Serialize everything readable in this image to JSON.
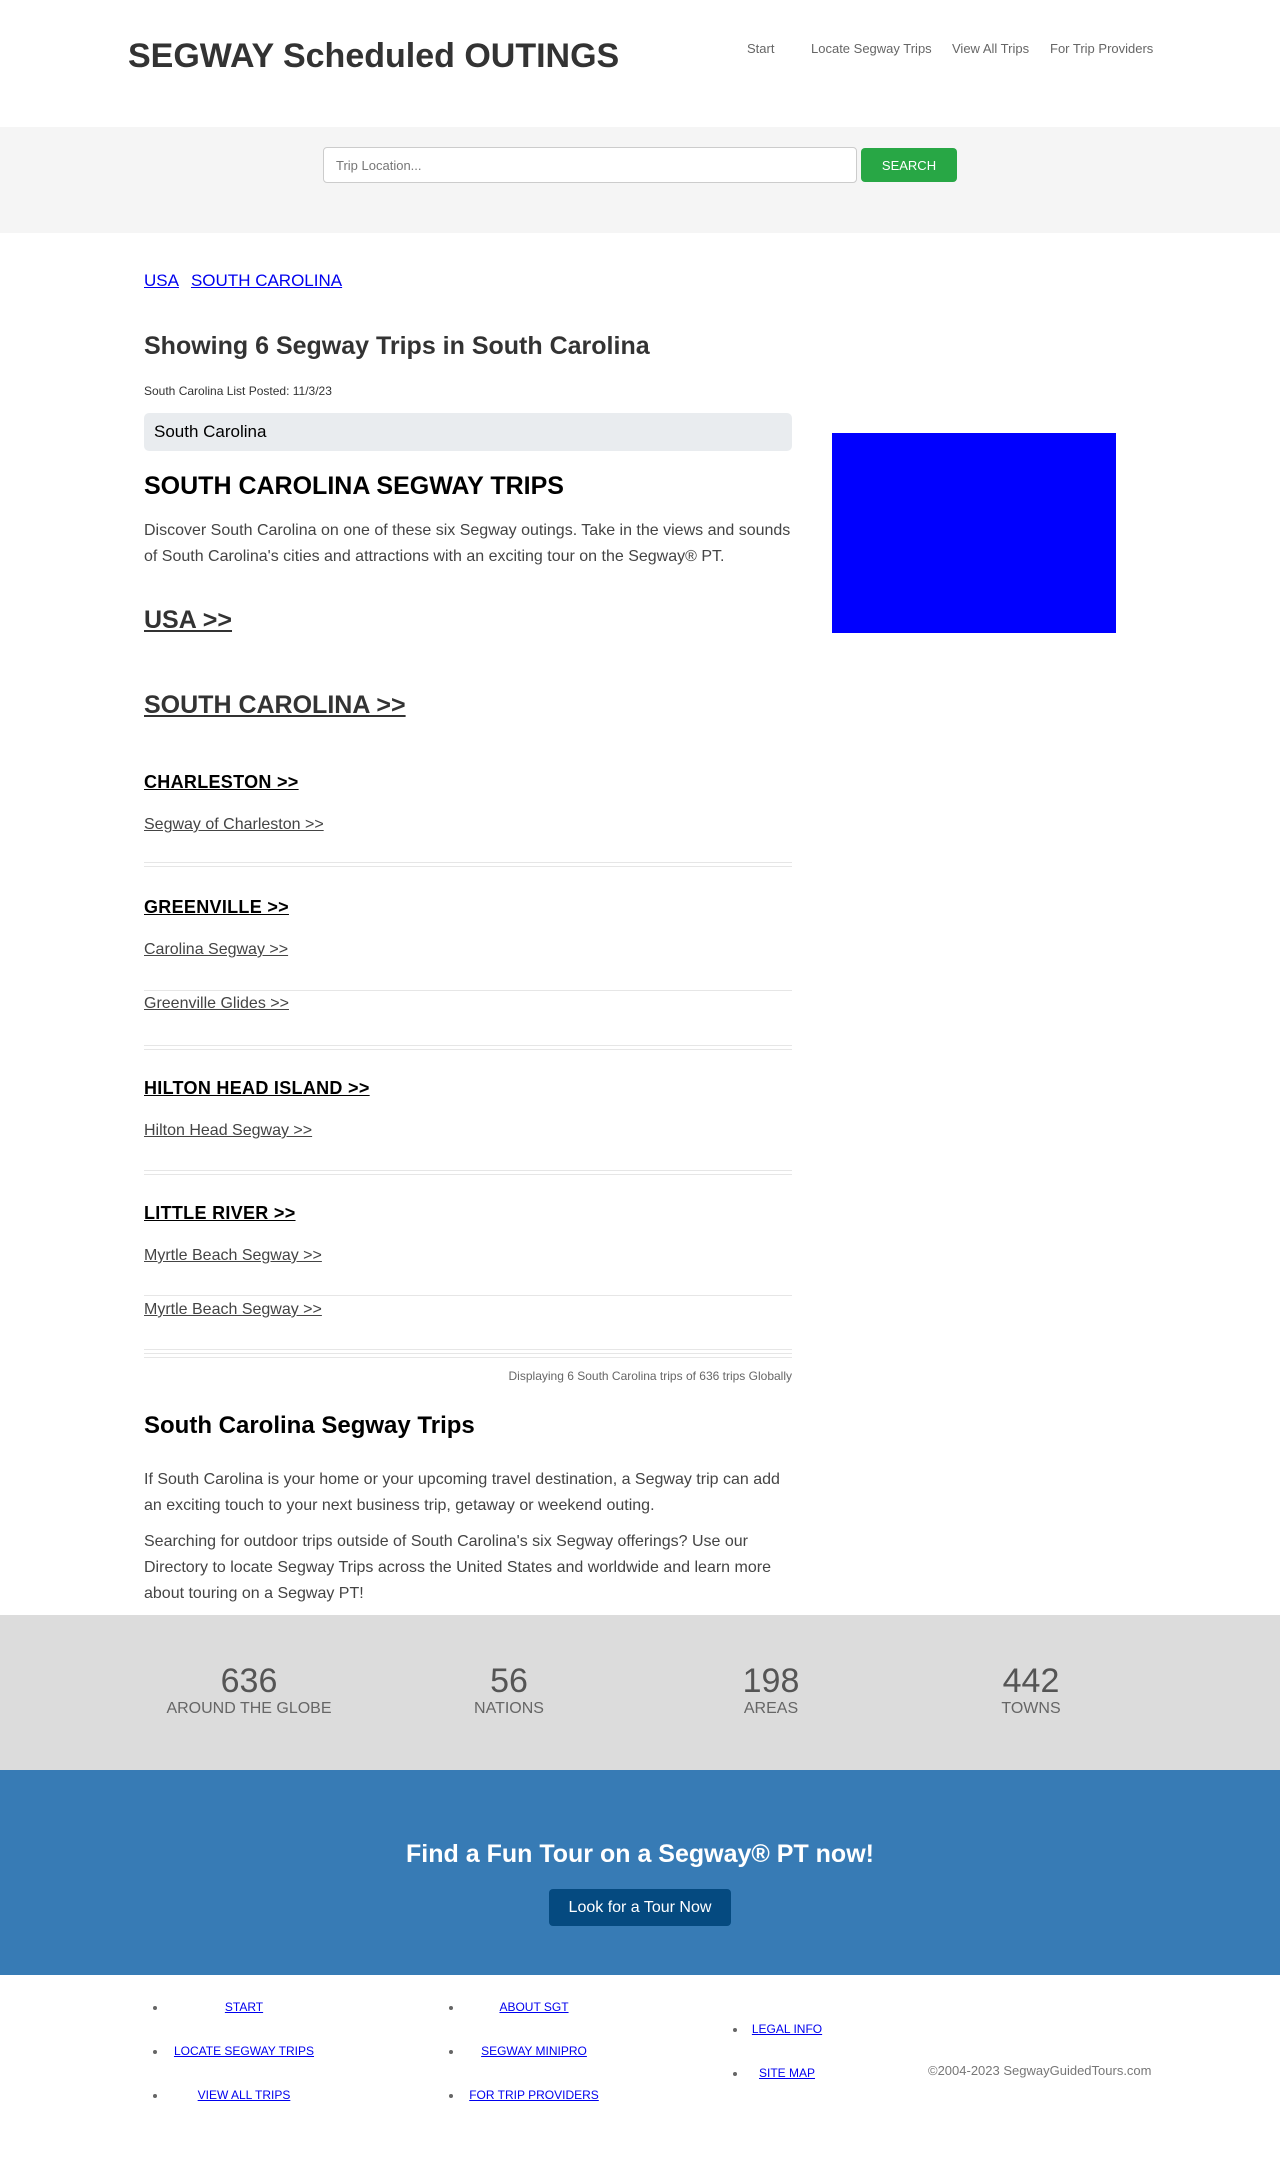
{
  "header": {
    "title": "SEGWAY Scheduled OUTINGS",
    "nav": [
      "Start",
      "Locate Segway Trips",
      "View All Trips",
      "For Trip Providers"
    ]
  },
  "search": {
    "placeholder": "Trip Location...",
    "button": "SEARCH"
  },
  "breadcrumb": [
    "USA",
    "SOUTH CAROLINA"
  ],
  "main": {
    "showing_title": "Showing 6 Segway Trips in South Carolina",
    "posted": "South Carolina List Posted: 11/3/23",
    "region": "South Carolina",
    "section_title": "SOUTH CAROLINA SEGWAY TRIPS",
    "intro": "Discover South Carolina on one of these six Segway outings. Take in the views and sounds of South Carolina's cities and attractions with an exciting tour on the Segway® PT.",
    "usa_link": "USA >>",
    "state_link": "SOUTH CAROLINA >>",
    "cities": [
      {
        "name": "CHARLESTON >>",
        "trips": [
          "Segway of Charleston >>"
        ]
      },
      {
        "name": "GREENVILLE >>",
        "trips": [
          "Carolina Segway >>",
          "Greenville Glides >>"
        ]
      },
      {
        "name": "HILTON HEAD ISLAND >>",
        "trips": [
          "Hilton Head Segway >>"
        ]
      },
      {
        "name": "LITTLE RIVER >>",
        "trips": [
          "Myrtle Beach Segway >>",
          "Myrtle Beach Segway >>"
        ]
      }
    ],
    "displaying": "Displaying 6 South Carolina trips of 636 trips Globally",
    "about_title": "South Carolina Segway Trips",
    "about_p1": "If South Carolina is your home or your upcoming travel destination, a Segway trip can add an exciting touch to your next business trip, getaway or weekend outing.",
    "about_p2": "Searching for outdoor trips outside of South Carolina's six Segway offerings? Use our Directory to locate Segway Trips across the United States and worldwide and learn more about touring on a Segway PT!"
  },
  "stats": [
    {
      "value": "636",
      "label": "AROUND THE GLOBE"
    },
    {
      "value": "56",
      "label": "NATIONS"
    },
    {
      "value": "198",
      "label": "AREAS"
    },
    {
      "value": "442",
      "label": "TOWNS"
    }
  ],
  "cta": {
    "title": "Find a Fun Tour on a Segway® PT now!",
    "button": "Look for a Tour Now"
  },
  "footer": {
    "col1": [
      "START",
      "LOCATE SEGWAY TRIPS",
      "VIEW ALL TRIPS"
    ],
    "col2": [
      "ABOUT SGT",
      "SEGWAY MINIPRO",
      "FOR TRIP PROVIDERS"
    ],
    "col3": [
      "LEGAL INFO",
      "SITE MAP"
    ],
    "copyright": "©2004-2023 SegwayGuidedTours.com"
  },
  "colors": {
    "search_button": "#28a745",
    "stats_bg": "#dcdcdc",
    "cta_bg": "#377bb5",
    "cta_button": "#054a80",
    "ad_box": "#0000ff"
  }
}
